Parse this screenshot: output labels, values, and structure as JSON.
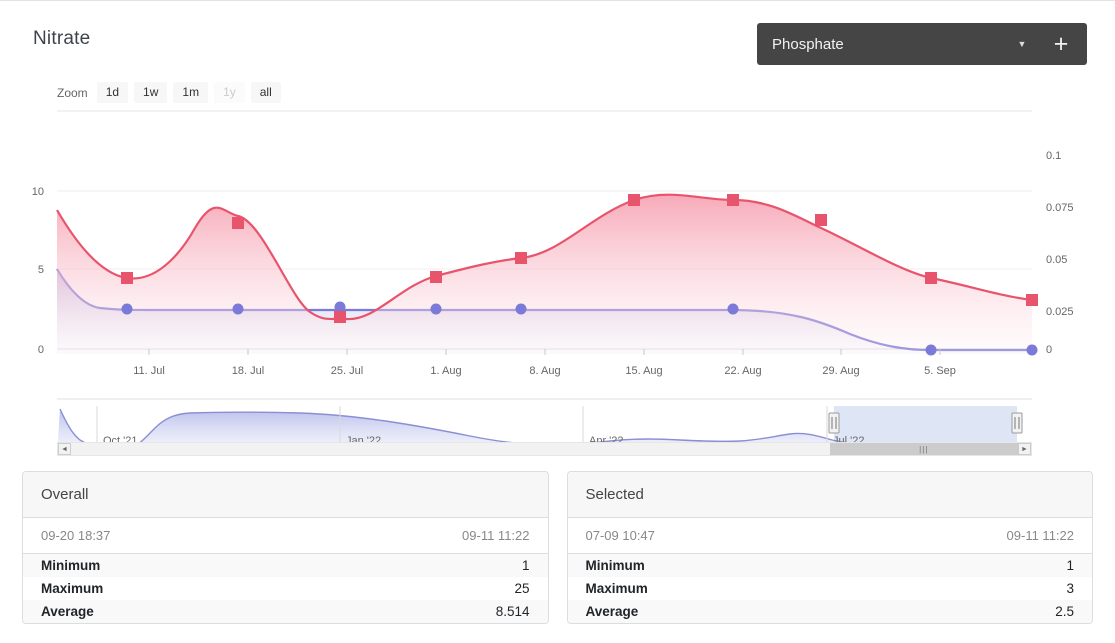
{
  "header": {
    "title": "Nitrate",
    "selector": {
      "value": "Phosphate",
      "caret_icon": "chevron-down-icon",
      "add_icon": "plus-icon",
      "background": "#454545"
    }
  },
  "zoom": {
    "caption": "Zoom",
    "buttons": [
      {
        "label": "1d",
        "disabled": false
      },
      {
        "label": "1w",
        "disabled": false
      },
      {
        "label": "1m",
        "disabled": false
      },
      {
        "label": "1y",
        "disabled": true
      },
      {
        "label": "all",
        "disabled": false
      }
    ]
  },
  "chart_data": {
    "type": "line",
    "title": "Nitrate",
    "xlabel": "",
    "ylabel": "",
    "grid": true,
    "legend_position": "none",
    "x": [
      "11. Jul",
      "18. Jul",
      "25. Jul",
      "1. Aug",
      "8. Aug",
      "15. Aug",
      "22. Aug",
      "29. Aug",
      "5. Sep"
    ],
    "xticks": [
      "11. Jul",
      "18. Jul",
      "25. Jul",
      "1. Aug",
      "8. Aug",
      "15. Aug",
      "22. Aug",
      "29. Aug",
      "5. Sep"
    ],
    "yticks_left": [
      "0",
      "5",
      "10"
    ],
    "ylim_left": [
      0,
      10
    ],
    "yticks_right": [
      "0",
      "0.025",
      "0.05",
      "0.075",
      "0.1"
    ],
    "ylim_right": [
      0,
      0.1
    ],
    "series": [
      {
        "name": "Nitrate",
        "axis": "left",
        "color": "#e8546b",
        "fill": "#f8c5cf",
        "marker": "square",
        "points": [
          {
            "x": "11. Jul",
            "y": 4.5
          },
          {
            "x": "18. Jul",
            "y": 8.3
          },
          {
            "x": "25. Jul",
            "y": 2.2
          },
          {
            "x": "1. Aug",
            "y": 4.5
          },
          {
            "x": "8. Aug",
            "y": 5.6
          },
          {
            "x": "15. Aug",
            "y": 9.4
          },
          {
            "x": "22. Aug",
            "y": 9.4
          },
          {
            "x": "29. Aug",
            "y": 8.2
          },
          {
            "x": "5. Sep",
            "y": 4.5
          }
        ]
      },
      {
        "name": "Phosphate",
        "axis": "right",
        "color": "#7b7ad8",
        "fill": "#cfcdee",
        "marker": "circle",
        "points": [
          {
            "x": "11. Jul",
            "y": 0.027
          },
          {
            "x": "18. Jul",
            "y": 0.027
          },
          {
            "x": "25. Jul",
            "y": 0.027
          },
          {
            "x": "1. Aug",
            "y": 0.027
          },
          {
            "x": "8. Aug",
            "y": 0.027
          },
          {
            "x": "22. Aug",
            "y": 0.027
          },
          {
            "x": "5. Sep",
            "y": 0.008
          }
        ]
      }
    ]
  },
  "navigator": {
    "ticks": [
      "Oct '21",
      "Jan '22",
      "Apr '22",
      "Jul '22"
    ],
    "selection_start_pct": 79.8,
    "selection_end_pct": 98.6,
    "left_arrow_icon": "triangle-left-icon",
    "right_arrow_icon": "triangle-right-icon",
    "thumb_grip_icon": "grip-icon",
    "handle_icon": "handle-grip-icon"
  },
  "panels": [
    {
      "title": "Overall",
      "range_start": "09-20 18:37",
      "range_end": "09-11 11:22",
      "stats": [
        {
          "key": "Minimum",
          "value": "1"
        },
        {
          "key": "Maximum",
          "value": "25"
        },
        {
          "key": "Average",
          "value": "8.514"
        }
      ]
    },
    {
      "title": "Selected",
      "range_start": "07-09 10:47",
      "range_end": "09-11 11:22",
      "stats": [
        {
          "key": "Minimum",
          "value": "1"
        },
        {
          "key": "Maximum",
          "value": "3"
        },
        {
          "key": "Average",
          "value": "2.5"
        }
      ]
    }
  ]
}
